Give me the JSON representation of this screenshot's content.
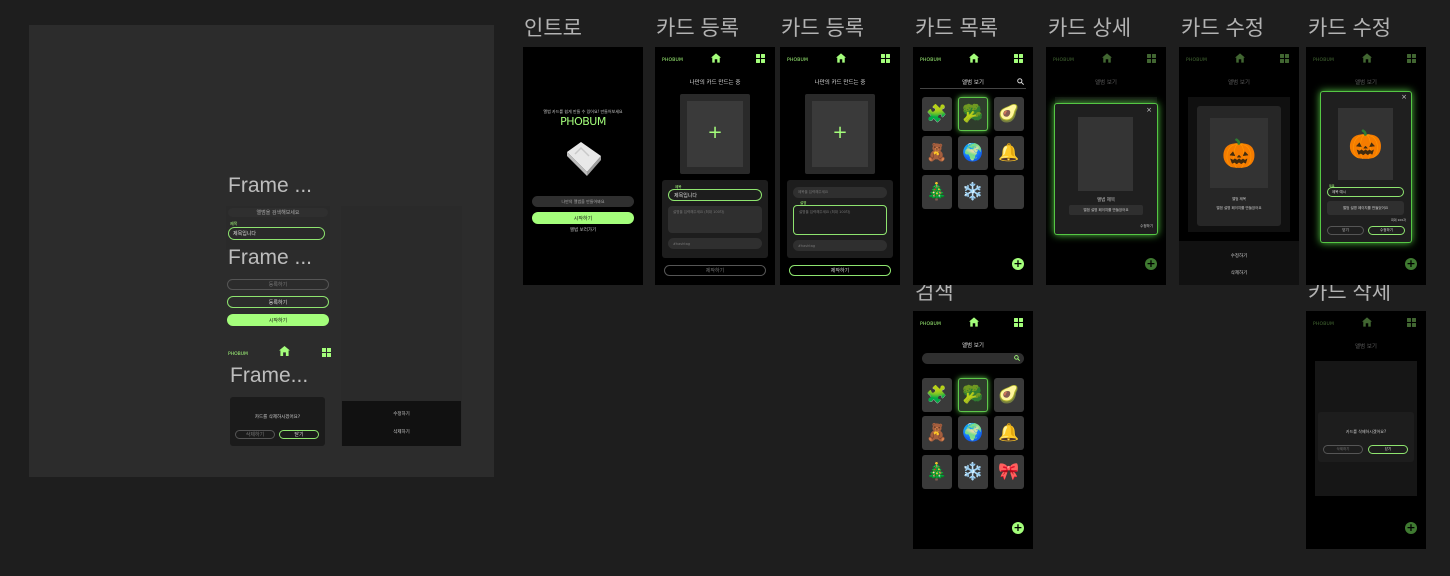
{
  "colors": {
    "accent": "#a4fe7b",
    "canvas": "#1e1e1e",
    "board": "#2c2c2c",
    "screen": "#000000"
  },
  "components": {
    "frame_label_1": "Frame ...",
    "frame_label_2": "Frame ...",
    "frame_label_3": "Frame...",
    "search_pill": "앨범을 검색해보세요",
    "title_field_label": "제목",
    "title_field_value": "제목입니다",
    "sub_pill": "설명을 입력해주세요",
    "register_dim": "등록하기",
    "register": "등록하기",
    "start": "시작하기",
    "brand": "PHOBUM",
    "delete_confirm": "카드를 삭제하시겠어요?",
    "cancel": "삭제하기",
    "close": "닫기",
    "edit": "수정하기",
    "delete": "삭제하기"
  },
  "frames": [
    {
      "label": "인트로"
    },
    {
      "label": "카드 등록"
    },
    {
      "label": "카드 등록"
    },
    {
      "label": "카드 목록"
    },
    {
      "label": "카드 상세"
    },
    {
      "label": "카드 수정"
    },
    {
      "label": "카드 수정"
    },
    {
      "label": "검색"
    },
    {
      "label": "카드 삭제"
    }
  ],
  "intro": {
    "tagline": "앨범 카드를 쉽게 만들 수 있어요! 만들어보세요",
    "brand": "PHOBUM",
    "input_placeholder": "나만의 앨범을 만들어봐요",
    "start": "시작하기",
    "browse": "앨범 보러가기"
  },
  "register": {
    "brand": "PHOBUM",
    "title": "나만의 카드 만드는 중",
    "plus": "+",
    "title_label": "제목",
    "title_value": "제목입니다",
    "title_placeholder": "제목을 입력해주세요",
    "desc_placeholder": "설명을 입력해주세요 (최대 100자)",
    "desc_label": "설명",
    "hashtag": "#hashtag",
    "submit": "제작하기"
  },
  "list": {
    "brand": "PHOBUM",
    "title": "앨범 보기",
    "plus": "+",
    "icons": [
      "🧩",
      "🥦",
      "🥑",
      "🧸",
      "🌍",
      "🔔",
      "🎄",
      "❄️",
      ""
    ]
  },
  "search": {
    "label": "검색",
    "brand": "PHOBUM",
    "title": "앨범 보기",
    "plus": "+",
    "icons": [
      "🧩",
      "🥦",
      "🥑",
      "🧸",
      "🌍",
      "🔔",
      "🎄",
      "❄️",
      "🎀"
    ]
  },
  "detail": {
    "brand": "PHOBUM",
    "title": "앨범 보기",
    "card_title": "앨범 제목",
    "card_desc": "앨범 설명 페이지를 만들었어요",
    "more": "수정하기",
    "close": "×",
    "plus": "+"
  },
  "edit1": {
    "brand": "PHOBUM",
    "title": "앨범 보기",
    "card_title": "앨범 제목",
    "card_desc": "앨범 설명 페이지를 만들었어요",
    "pumpkin": "🎃",
    "edit": "수정하기",
    "delete": "삭제하기"
  },
  "edit2": {
    "brand": "PHOBUM",
    "title": "앨범 보기",
    "pumpkin": "🎃",
    "title_label": "제목",
    "title_value": "제목 예시",
    "desc_value": "앨범 설명 페이지를 만들었어요",
    "hint": "최대 100자",
    "cancel": "닫기",
    "save": "수정하기",
    "close": "×",
    "plus": "+"
  },
  "delete_screen": {
    "brand": "PHOBUM",
    "title": "앨범 보기",
    "confirm": "카드를 삭제하시겠어요?",
    "cancel": "삭제하기",
    "ok": "닫기",
    "plus": "+"
  }
}
